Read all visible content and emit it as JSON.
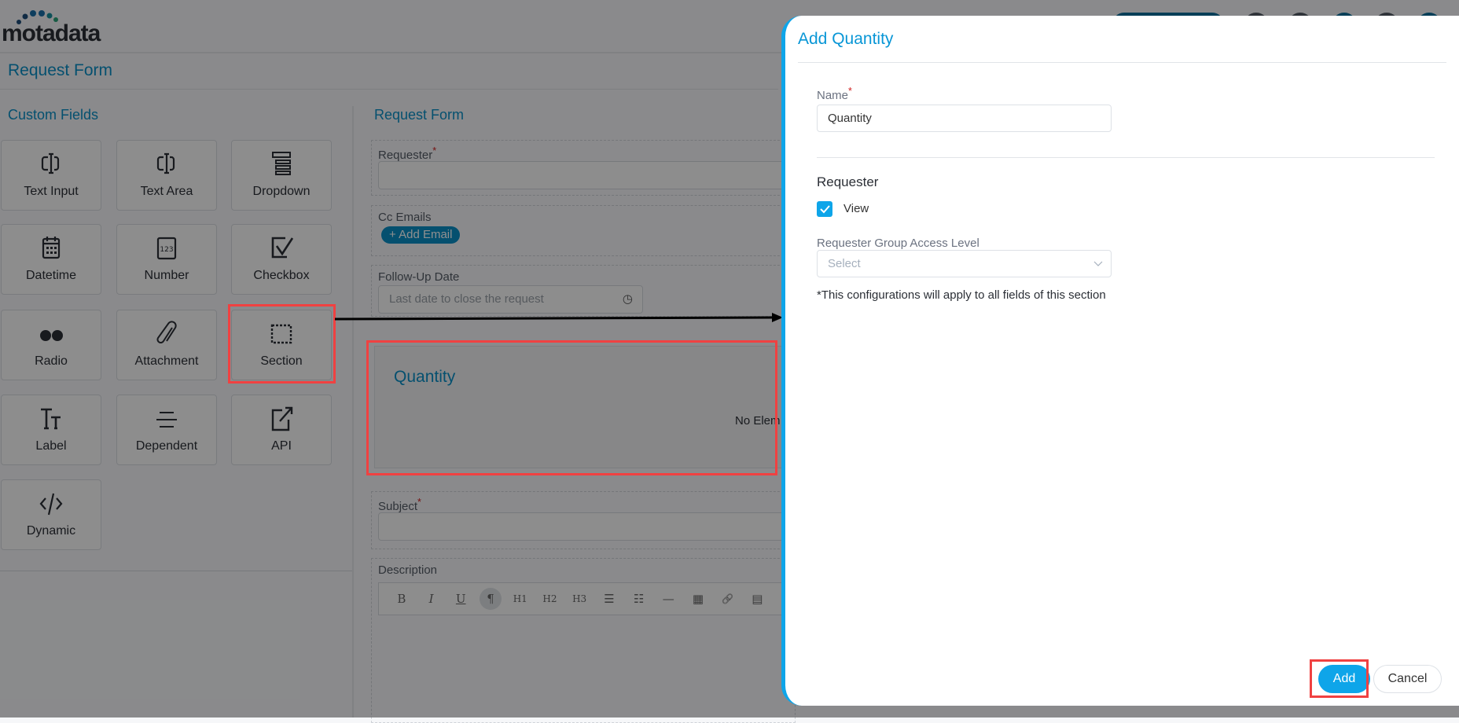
{
  "app": {
    "logo_text": "motadata",
    "page_title": "Request Form"
  },
  "custom_fields": {
    "title": "Custom Fields",
    "items": [
      {
        "label": "Text Input",
        "icon": "text-cursor-icon"
      },
      {
        "label": "Text Area",
        "icon": "text-cursor-icon"
      },
      {
        "label": "Dropdown",
        "icon": "dropdown-list-icon"
      },
      {
        "label": "Datetime",
        "icon": "calendar-icon"
      },
      {
        "label": "Number",
        "icon": "number-123-icon"
      },
      {
        "label": "Checkbox",
        "icon": "checkbox-icon"
      },
      {
        "label": "Radio",
        "icon": "radio-dots-icon"
      },
      {
        "label": "Attachment",
        "icon": "paperclip-icon"
      },
      {
        "label": "Section",
        "icon": "dashed-square-icon"
      },
      {
        "label": "Label",
        "icon": "text-size-icon"
      },
      {
        "label": "Dependent",
        "icon": "lines-icon"
      },
      {
        "label": "API",
        "icon": "external-link-icon"
      },
      {
        "label": "Dynamic",
        "icon": "code-icon"
      }
    ]
  },
  "form": {
    "title": "Request Form",
    "requester_label": "Requester",
    "cc_label": "Cc Emails",
    "add_email": "+ Add Email",
    "followup_label": "Follow-Up Date",
    "followup_placeholder": "Last date to close the request",
    "section_title": "Quantity",
    "section_empty": "No Elem",
    "subject_label": "Subject",
    "description_label": "Description",
    "toolbar": [
      "B",
      "I",
      "U",
      "¶",
      "H1",
      "H2",
      "H3",
      "☰",
      "☷",
      "—",
      "▦",
      "🔗",
      "▤",
      "▨"
    ]
  },
  "modal": {
    "title": "Add Quantity",
    "name_label": "Name",
    "name_value": "Quantity",
    "requester_heading": "Requester",
    "view_label": "View",
    "view_checked": true,
    "access_label": "Requester Group Access Level",
    "access_placeholder": "Select",
    "note": "*This configurations will apply to all fields of this section",
    "add_label": "Add",
    "cancel_label": "Cancel"
  },
  "colors": {
    "accent": "#0ea5e9",
    "annotation": "#f04141"
  }
}
